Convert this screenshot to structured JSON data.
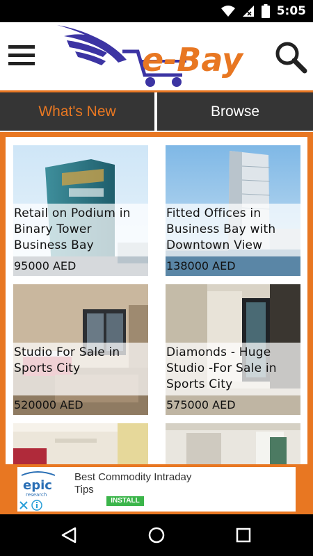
{
  "status_bar": {
    "time": "5:05",
    "icons": [
      "wifi-icon",
      "signal-icon",
      "battery-icon"
    ]
  },
  "header": {
    "logo_text": "e-Bay",
    "menu_icon": "hamburger-menu-icon",
    "search_icon": "search-icon",
    "colors": {
      "brand_orange": "#e87722",
      "brand_blue": "#3c34a3"
    }
  },
  "tabs": [
    {
      "label": "What's New",
      "active": true
    },
    {
      "label": "Browse",
      "active": false
    }
  ],
  "listings": [
    {
      "title": "Retail on Podium in Binary Tower Business Bay",
      "price": "95000 AED"
    },
    {
      "title": "Fitted Offices in Business Bay with Downtown View",
      "price": "138000 AED"
    },
    {
      "title": "Studio For Sale in Sports City",
      "price": "520000 AED"
    },
    {
      "title": "Diamonds  - Huge Studio -For Sale  in Sports City",
      "price": "575000 AED"
    }
  ],
  "ad": {
    "brand": "epic",
    "brand_sub": "research",
    "title": "Best Commodity Intraday Tips",
    "cta": "INSTALL"
  },
  "nav_bar": {
    "icons": [
      "back-icon",
      "home-icon",
      "recents-icon"
    ]
  }
}
